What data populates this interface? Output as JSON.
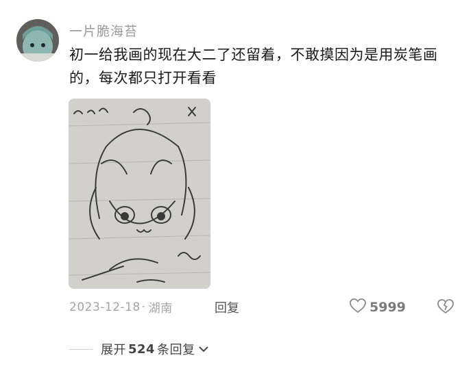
{
  "comment": {
    "username": "一片脆海苔",
    "text": "初一给我画的现在大二了还留着，不敢摸因为是用炭笔画的，每次都只打开看看",
    "date": "2023-12-18",
    "separator": "·",
    "location": "湖南",
    "reply_label": "回复",
    "likes": "5999"
  },
  "expand": {
    "prefix": "展开",
    "count": "524",
    "suffix": "条回复"
  },
  "icons": {
    "like": "heart-icon",
    "dislike": "broken-heart-icon",
    "expand": "chevron-down-icon"
  },
  "colors": {
    "text_primary": "#1a1a1a",
    "text_secondary": "#9a9a9a"
  }
}
